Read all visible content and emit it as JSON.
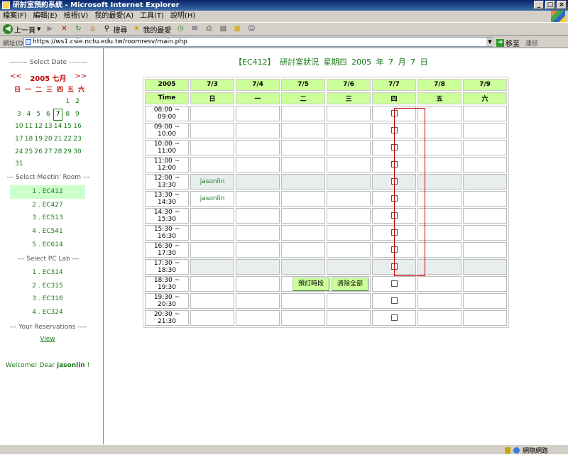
{
  "window": {
    "title": "研討室預約系統 - Microsoft Internet Explorer",
    "minimize": "_",
    "maximize": "□",
    "close": "×"
  },
  "menu": [
    "檔案(F)",
    "編輯(E)",
    "檢視(V)",
    "我的最愛(A)",
    "工具(T)",
    "說明(H)"
  ],
  "toolbar": {
    "back": "上一頁",
    "search": "搜尋",
    "favorites": "我的最愛"
  },
  "address": {
    "label": "網址(D)",
    "url": "https://ws1.csie.nctu.edu.tw/roomresv/main.php",
    "go": "移至",
    "links": "連結"
  },
  "sidebar": {
    "date_section": "-------- Select Date --------",
    "calendar": {
      "prev": "<<",
      "month": "2005 七月",
      "next": ">>",
      "weekdays": [
        "日",
        "一",
        "二",
        "三",
        "四",
        "五",
        "六"
      ],
      "days": [
        "",
        "",
        "",
        "",
        "",
        "1",
        "2",
        "3",
        "4",
        "5",
        "6",
        "7",
        "8",
        "9",
        "10",
        "11",
        "12",
        "13",
        "14",
        "15",
        "16",
        "17",
        "18",
        "19",
        "20",
        "21",
        "22",
        "23",
        "24",
        "25",
        "26",
        "27",
        "28",
        "29",
        "30",
        "31"
      ],
      "selected_day": "7"
    },
    "room_section": "--- Select Meetin' Room ---",
    "rooms": [
      "1 . EC412",
      "2 . EC427",
      "3 . EC513",
      "4 . EC541",
      "5 . EC614"
    ],
    "pc_section": "---     Select PC Lab     ---",
    "labs": [
      "1 . EC314",
      "2 . EC315",
      "3 . EC316",
      "4 . EC324"
    ],
    "res_section": "--- Your Reservations ----",
    "view": "View",
    "welcome_prefix": "Welcome! Dear ",
    "welcome_user": "jasonlin",
    "welcome_suffix": " !"
  },
  "main": {
    "title": "【EC412】  研討室狀況  星期四  2005  年  7  月  7  日",
    "year": "2005",
    "time_header": "Time",
    "dates": [
      "7/3",
      "7/4",
      "7/5",
      "7/6",
      "7/7",
      "7/8",
      "7/9"
    ],
    "weekdays": [
      "日",
      "一",
      "二",
      "三",
      "四",
      "五",
      "六"
    ],
    "rows": [
      {
        "time": "08:00 ~ 09:00",
        "cells": [
          "",
          "",
          "",
          "",
          "cb",
          "",
          ""
        ]
      },
      {
        "time": "09:00 ~ 10:00",
        "cells": [
          "",
          "",
          "",
          "",
          "cb",
          "",
          ""
        ]
      },
      {
        "time": "10:00 ~ 11:00",
        "cells": [
          "",
          "",
          "",
          "",
          "cb",
          "",
          ""
        ]
      },
      {
        "time": "11:00 ~ 12:00",
        "cells": [
          "",
          "",
          "",
          "",
          "cb",
          "",
          ""
        ]
      },
      {
        "time": "12:00 ~ 13:30",
        "cells": [
          "jasonlin",
          "",
          "",
          "",
          "cb",
          "",
          ""
        ],
        "shaded": true
      },
      {
        "time": "13:30 ~ 14:30",
        "cells": [
          "jasonlin",
          "",
          "",
          "",
          "cb",
          "",
          ""
        ]
      },
      {
        "time": "14:30 ~ 15:30",
        "cells": [
          "",
          "",
          "",
          "",
          "cb",
          "",
          ""
        ]
      },
      {
        "time": "15:30 ~ 16:30",
        "cells": [
          "",
          "",
          "",
          "",
          "cb",
          "",
          ""
        ]
      },
      {
        "time": "16:30 ~ 17:30",
        "cells": [
          "",
          "",
          "",
          "",
          "cb",
          "",
          ""
        ]
      },
      {
        "time": "17:30 ~ 18:30",
        "cells": [
          "",
          "",
          "",
          "",
          "cb",
          "",
          ""
        ],
        "shaded": true
      },
      {
        "time": "18:30 ~ 19:30",
        "cells": [
          "",
          "",
          "",
          "",
          "cb",
          "",
          ""
        ]
      },
      {
        "time": "19:30 ~ 20:30",
        "cells": [
          "",
          "",
          "",
          "",
          "cb",
          "",
          ""
        ]
      },
      {
        "time": "20:30 ~ 21:30",
        "cells": [
          "",
          "",
          "",
          "",
          "cb",
          "",
          ""
        ]
      }
    ],
    "reserve_button": "預訂時段",
    "clear_button": "清除全部"
  },
  "status": {
    "zone": "網際網路"
  },
  "colors": {
    "header_green": "#ccff99",
    "link_green": "#1a7a1a",
    "accent_red": "#c00000",
    "active_room": "#ccffcc"
  }
}
